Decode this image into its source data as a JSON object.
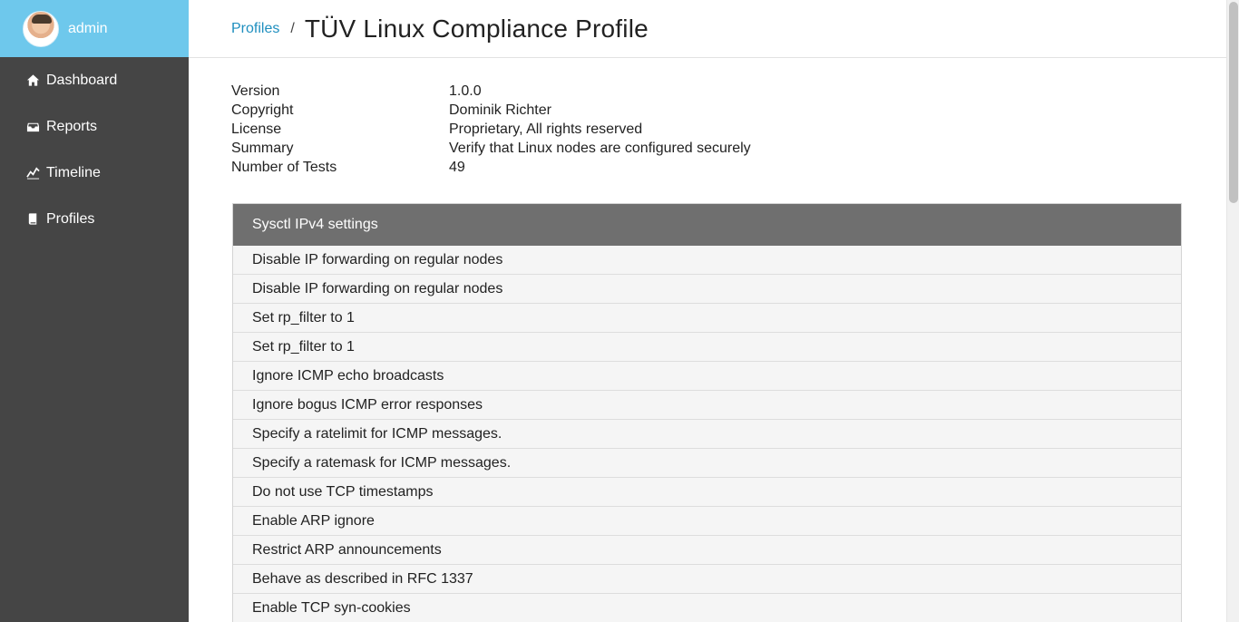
{
  "user": {
    "name": "admin"
  },
  "sidebar": {
    "items": [
      {
        "label": "Dashboard",
        "icon": "home-icon"
      },
      {
        "label": "Reports",
        "icon": "inbox-icon"
      },
      {
        "label": "Timeline",
        "icon": "line-chart-icon"
      },
      {
        "label": "Profiles",
        "icon": "book-icon"
      }
    ]
  },
  "breadcrumb": {
    "link": "Profiles",
    "separator": "/",
    "title": "TÜV Linux Compliance Profile"
  },
  "meta": [
    {
      "label": "Version",
      "value": "1.0.0"
    },
    {
      "label": "Copyright",
      "value": "Dominik Richter"
    },
    {
      "label": "License",
      "value": "Proprietary, All rights reserved"
    },
    {
      "label": "Summary",
      "value": "Verify that Linux nodes are configured securely"
    },
    {
      "label": "Number of Tests",
      "value": "49"
    }
  ],
  "panel": {
    "title": "Sysctl IPv4 settings",
    "items": [
      "Disable IP forwarding on regular nodes",
      "Disable IP forwarding on regular nodes",
      "Set rp_filter to 1",
      "Set rp_filter to 1",
      "Ignore ICMP echo broadcasts",
      "Ignore bogus ICMP error responses",
      "Specify a ratelimit for ICMP messages.",
      "Specify a ratemask for ICMP messages.",
      "Do not use TCP timestamps",
      "Enable ARP ignore",
      "Restrict ARP announcements",
      "Behave as described in RFC 1337",
      "Enable TCP syn-cookies"
    ]
  },
  "colors": {
    "sidebar_bg": "#454545",
    "user_bar_bg": "#6ec8ec",
    "link": "#1f8fbf",
    "panel_header_bg": "#6f6f6f"
  }
}
